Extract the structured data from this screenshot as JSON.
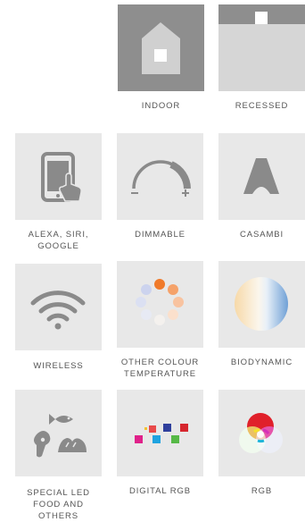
{
  "features": [
    {
      "key": "indoor",
      "label": "INDOOR",
      "icon": "house-icon"
    },
    {
      "key": "recessed",
      "label": "RECESSED",
      "icon": "recessed-icon"
    },
    {
      "key": "alexa",
      "label": "ALEXA, SIRI,\nGOOGLE",
      "icon": "phone-touch-icon"
    },
    {
      "key": "dimmable",
      "label": "DIMMABLE",
      "icon": "dimmer-dial-icon"
    },
    {
      "key": "casambi",
      "label": "CASAMBI",
      "icon": "casambi-logo-icon"
    },
    {
      "key": "wireless",
      "label": "WIRELESS",
      "icon": "wifi-icon"
    },
    {
      "key": "colour_temp",
      "label": "OTHER COLOUR\nTEMPERATURE",
      "icon": "colour-temperature-icon"
    },
    {
      "key": "biodynamic",
      "label": "BIODYNAMIC",
      "icon": "biodynamic-gradient-icon"
    },
    {
      "key": "special_led",
      "label": "SPECIAL LED\nFOOD AND\nOTHERS",
      "icon": "food-icon"
    },
    {
      "key": "digital_rgb",
      "label": "DIGITAL RGB",
      "icon": "pixel-squares-icon"
    },
    {
      "key": "rgb",
      "label": "RGB",
      "icon": "rgb-circles-icon"
    }
  ],
  "colors": {
    "tile_bg": "#e8e8e8",
    "icon_grey": "#8a8a8a",
    "label_text": "#555555"
  }
}
